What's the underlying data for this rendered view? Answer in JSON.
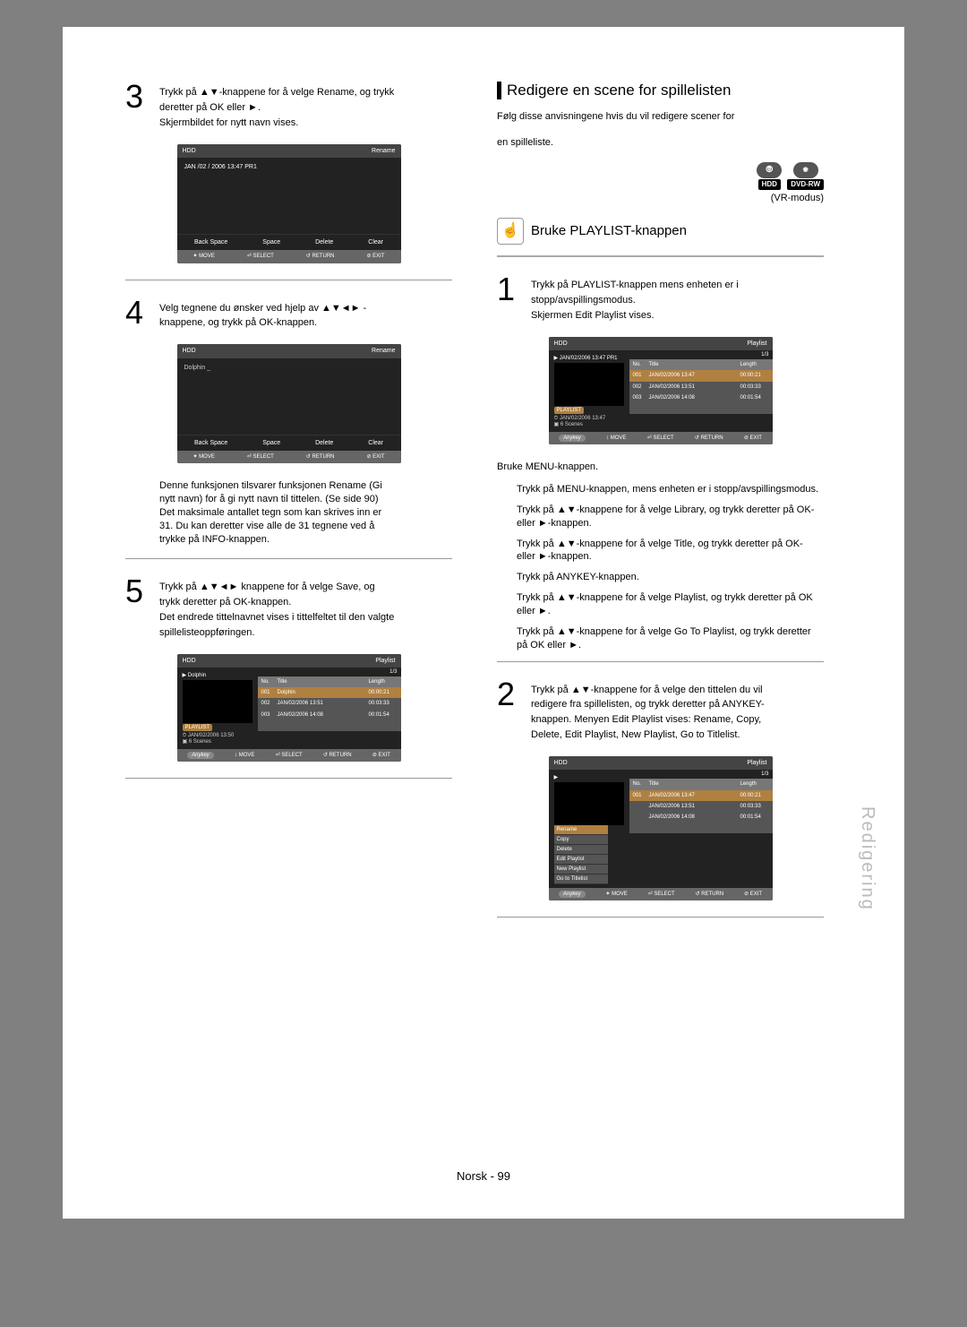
{
  "page": {
    "footer": "Norsk - 99",
    "sidebar": "Redigering"
  },
  "left": {
    "step3": {
      "num": "3",
      "l1": "Trykk på ▲▼-knappene for å velge Rename, og trykk",
      "l2": "deretter på OK eller ►.",
      "l3": "Skjermbildet for nytt navn vises."
    },
    "step4": {
      "num": "4",
      "l1": "Velg tegnene du ønsker ved hjelp av ▲▼◄► -",
      "l2": "knappene, og trykk på OK-knappen."
    },
    "blurb": {
      "l1": "Denne funksjonen tilsvarer funksjonen Rename (Gi",
      "l2": "nytt navn) for å gi nytt navn til tittelen. (Se side 90)",
      "l3": "Det maksimale antallet tegn som kan skrives inn er",
      "l4": "31. Du kan deretter vise alle de 31 tegnene ved å",
      "l5": "trykke på INFO-knappen."
    },
    "step5": {
      "num": "5",
      "l1": "Trykk på ▲▼◄► knappene for å velge Save, og",
      "l2": "trykk deretter på OK-knappen.",
      "l3": "Det endrede tittelnavnet vises i tittelfeltet til den valgte",
      "l4": "spillelisteoppføringen."
    }
  },
  "right": {
    "section_title": "Redigere en scene for spillelisten",
    "intro1": "Følg disse anvisningene hvis du vil redigere scener for",
    "intro2": "en spilleliste.",
    "badge_hdd": "HDD",
    "badge_dvd": "DVD-RW",
    "vr_mode": "(VR-modus)",
    "sub1": "Bruke PLAYLIST-knappen",
    "step1": {
      "num": "1",
      "l1": "Trykk på PLAYLIST-knappen mens enheten er i",
      "l2": "stopp/avspillingsmodus.",
      "l3": "Skjermen Edit Playlist vises."
    },
    "menu_title": "Bruke MENU-knappen.",
    "menu_l1": "Trykk på MENU-knappen, mens enheten er i stopp/avspillingsmodus.",
    "menu_l2": "Trykk på ▲▼-knappene for å velge Library, og trykk deretter på OK- eller ►-knappen.",
    "menu_l3": "Trykk på ▲▼-knappene for å velge Title, og trykk deretter på OK- eller ►-knappen.",
    "menu_l4": "Trykk på ANYKEY-knappen.",
    "menu_l5": "Trykk på ▲▼-knappene for å velge Playlist, og trykk deretter på OK eller ►.",
    "menu_l6": "Trykk på ▲▼-knappene for å velge Go To Playlist, og trykk deretter på OK eller ►.",
    "step2": {
      "num": "2",
      "l1": "Trykk på ▲▼-knappene for å velge den tittelen du vil",
      "l2": "redigere fra spillelisten, og trykk deretter på ANYKEY-",
      "l3": "knappen. Menyen Edit Playlist vises: Rename, Copy,",
      "l4": "Delete, Edit Playlist, New Playlist, Go to Titlelist."
    }
  },
  "osd": {
    "hdd": "HDD",
    "rename": "Rename",
    "playlist": "Playlist",
    "line_ts": "JAN /02 / 2006  13:47  PR1",
    "line_ts2": "JAN/02/2006 13:47 PR1",
    "dolphin": "Dolphin",
    "dolphin_cursor": "Dolphin _",
    "backspace": "Back Space",
    "space": "Space",
    "delete": "Delete",
    "clear": "Clear",
    "move": "MOVE",
    "select": "SELECT",
    "return": "RETURN",
    "exit": "EXIT",
    "anykey": "Anykey",
    "no": "No.",
    "title": "Title",
    "length": "Length",
    "frac": "1/3",
    "r2_t": "JAN/02/2006 13:51",
    "r2_l": "00:03:33",
    "r3_t": "JAN/02/2006 14:08",
    "r3_l": "00:01:54",
    "pl_chip": "PLAYLIST",
    "pl_time_a": "JAN/02/2006 13:47",
    "pl_time_b": "JAN/02/2006 13:50",
    "scenes": "6 Scenes",
    "menu": {
      "rename": "Rename",
      "copy": "Copy",
      "delete": "Delete",
      "edit": "Edit Playlist",
      "new": "New Playlist",
      "goto": "Go to Titlelist"
    }
  }
}
